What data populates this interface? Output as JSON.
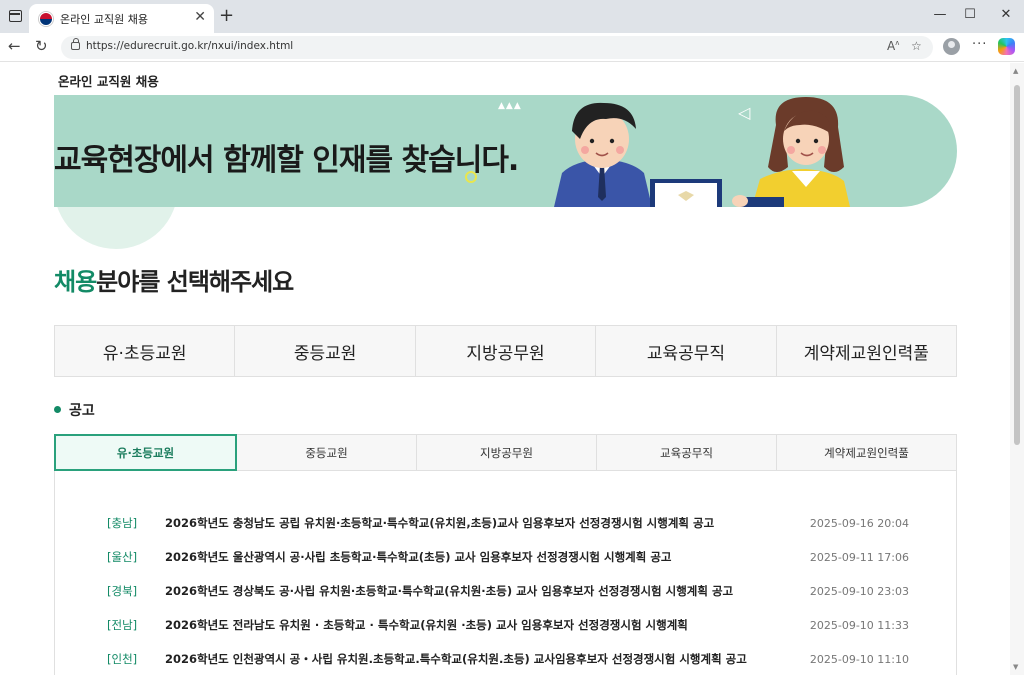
{
  "browser": {
    "tab_title": "온라인 교직원 채용",
    "url": "https://edurecruit.go.kr/nxui/index.html"
  },
  "site": {
    "title": "온라인 교직원 채용"
  },
  "banner": {
    "headline": "교육현장에서 함께할 인재를 찾습니다."
  },
  "section": {
    "heading_accent": "채용",
    "heading_rest": "분야를 선택해주세요"
  },
  "categories": [
    {
      "label": "유·초등교원"
    },
    {
      "label": "중등교원"
    },
    {
      "label": "지방공무원"
    },
    {
      "label": "교육공무직"
    },
    {
      "label": "계약제교원인력풀"
    }
  ],
  "notices": {
    "heading": "공고",
    "tabs": [
      {
        "label": "유·초등교원",
        "active": true
      },
      {
        "label": "중등교원",
        "active": false
      },
      {
        "label": "지방공무원",
        "active": false
      },
      {
        "label": "교육공무직",
        "active": false
      },
      {
        "label": "계약제교원인력풀",
        "active": false
      }
    ],
    "items": [
      {
        "region": "[충남]",
        "title": "2026학년도 충청남도 공립 유치원·초등학교·특수학교(유치원,초등)교사 임용후보자 선정경쟁시험 시행계획 공고",
        "date": "2025-09-16 20:04"
      },
      {
        "region": "[울산]",
        "title": "2026학년도 울산광역시 공·사립 초등학교·특수학교(초등) 교사 임용후보자 선정경쟁시험 시행계획 공고",
        "date": "2025-09-11 17:06"
      },
      {
        "region": "[경북]",
        "title": "2026학년도 경상북도 공·사립 유치원·초등학교·특수학교(유치원·초등) 교사 임용후보자 선정경쟁시험 시행계획 공고",
        "date": "2025-09-10 23:03"
      },
      {
        "region": "[전남]",
        "title": "2026학년도 전라남도 유치원 · 초등학교 · 특수학교(유치원 ·초등) 교사 임용후보자 선정경쟁시험 시행계획",
        "date": "2025-09-10 11:33"
      },
      {
        "region": "[인천]",
        "title": "2026학년도 인천광역시 공・사립 유치원.초등학교.특수학교(유치원.초등) 교사임용후보자 선정경쟁시험 시행계획 공고",
        "date": "2025-09-10 11:10"
      }
    ]
  },
  "colors": {
    "accent": "#138a66",
    "banner_bg": "#a9d8c8"
  }
}
